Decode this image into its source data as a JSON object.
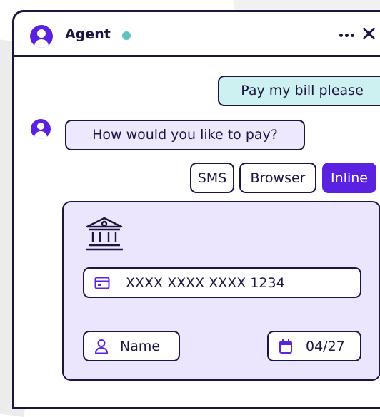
{
  "header": {
    "title": "Agent",
    "status_color": "#5bc2c4",
    "avatar_icon": "user-avatar-icon",
    "more_icon": "more-horizontal-icon",
    "close_icon": "close-icon"
  },
  "messages": [
    {
      "sender": "user",
      "text": "Pay my bill please"
    },
    {
      "sender": "agent",
      "text": "How would you like to pay?"
    }
  ],
  "payment_options": [
    "SMS",
    "Browser",
    "Inline"
  ],
  "selected_option": "Inline",
  "payment_card": {
    "icon": "bank-icon",
    "card_number": "XXXX XXXX XXXX 1234",
    "card_icon": "credit-card-icon",
    "name_placeholder": "Name",
    "name_icon": "person-icon",
    "expiry": "04/27",
    "expiry_icon": "calendar-icon"
  },
  "colors": {
    "accent": "#5b21e0",
    "dark": "#1f1340",
    "user_bubble": "#cdf0f0",
    "agent_bubble": "#ede8fd",
    "card_bg": "#ebe5fd"
  }
}
